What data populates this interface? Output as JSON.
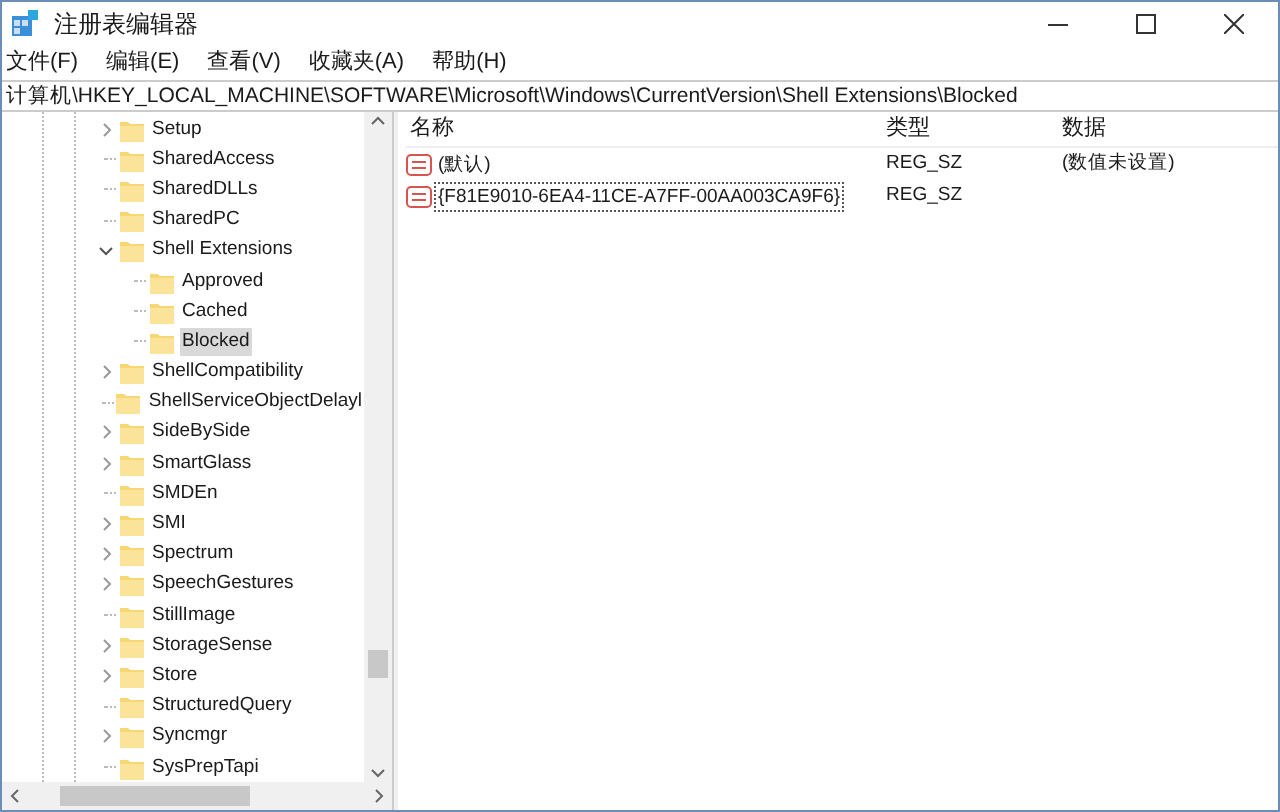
{
  "window": {
    "title": "注册表编辑器"
  },
  "menu": [
    "文件(F)",
    "编辑(E)",
    "查看(V)",
    "收藏夹(A)",
    "帮助(H)"
  ],
  "address": "计算机\\HKEY_LOCAL_MACHINE\\SOFTWARE\\Microsoft\\Windows\\CurrentVersion\\Shell Extensions\\Blocked",
  "tree": [
    {
      "label": "Setup",
      "kind": "branch",
      "expanded": false,
      "selected": false
    },
    {
      "label": "SharedAccess",
      "kind": "leaf",
      "selected": false
    },
    {
      "label": "SharedDLLs",
      "kind": "leaf",
      "selected": false
    },
    {
      "label": "SharedPC",
      "kind": "leaf",
      "selected": false
    },
    {
      "label": "Shell Extensions",
      "kind": "branch",
      "expanded": true,
      "selected": false,
      "children": [
        {
          "label": "Approved",
          "kind": "leaf",
          "selected": false
        },
        {
          "label": "Cached",
          "kind": "leaf",
          "selected": false
        },
        {
          "label": "Blocked",
          "kind": "leaf",
          "selected": true
        }
      ]
    },
    {
      "label": "ShellCompatibility",
      "kind": "branch",
      "expanded": false,
      "selected": false
    },
    {
      "label": "ShellServiceObjectDelayl",
      "kind": "leaf",
      "selected": false
    },
    {
      "label": "SideBySide",
      "kind": "branch",
      "expanded": false,
      "selected": false
    },
    {
      "label": "SmartGlass",
      "kind": "branch",
      "expanded": false,
      "selected": false
    },
    {
      "label": "SMDEn",
      "kind": "leaf",
      "selected": false
    },
    {
      "label": "SMI",
      "kind": "branch",
      "expanded": false,
      "selected": false
    },
    {
      "label": "Spectrum",
      "kind": "branch",
      "expanded": false,
      "selected": false
    },
    {
      "label": "SpeechGestures",
      "kind": "branch",
      "expanded": false,
      "selected": false
    },
    {
      "label": "StillImage",
      "kind": "leaf",
      "selected": false
    },
    {
      "label": "StorageSense",
      "kind": "branch",
      "expanded": false,
      "selected": false
    },
    {
      "label": "Store",
      "kind": "branch",
      "expanded": false,
      "selected": false
    },
    {
      "label": "StructuredQuery",
      "kind": "leaf",
      "selected": false
    },
    {
      "label": "Syncmgr",
      "kind": "branch",
      "expanded": false,
      "selected": false
    },
    {
      "label": "SysPrepTapi",
      "kind": "leaf",
      "selected": false
    }
  ],
  "values": {
    "columns": [
      "名称",
      "类型",
      "数据"
    ],
    "rows": [
      {
        "name": "(默认)",
        "type": "REG_SZ",
        "data": "(数值未设置)",
        "focused": false
      },
      {
        "name": "{F81E9010-6EA4-11CE-A7FF-00AA003CA9F6}",
        "type": "REG_SZ",
        "focused": true
      }
    ]
  }
}
